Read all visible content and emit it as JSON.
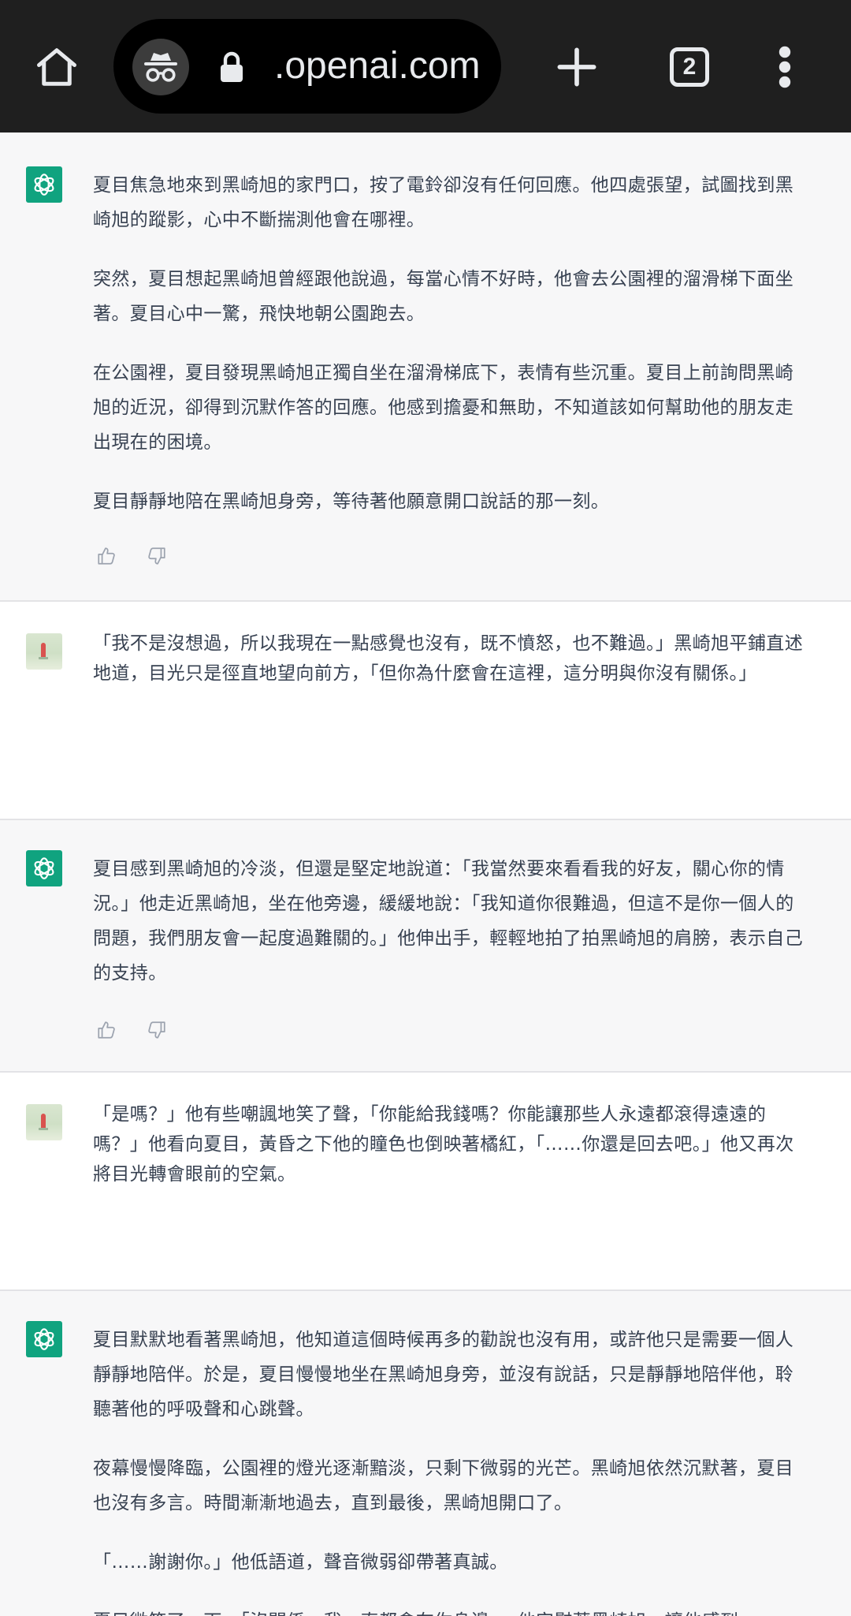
{
  "browser": {
    "url": ".openai.com",
    "tab_count": "2"
  },
  "messages": [
    {
      "role": "assistant",
      "paragraphs": [
        "夏目焦急地來到黑崎旭的家門口，按了電鈴卻沒有任何回應。他四處張望，試圖找到黑崎旭的蹤影，心中不斷揣測他會在哪裡。",
        "突然，夏目想起黑崎旭曾經跟他說過，每當心情不好時，他會去公園裡的溜滑梯下面坐著。夏目心中一驚，飛快地朝公園跑去。",
        "在公園裡，夏目發現黑崎旭正獨自坐在溜滑梯底下，表情有些沉重。夏目上前詢問黑崎旭的近況，卻得到沉默作答的回應。他感到擔憂和無助，不知道該如何幫助他的朋友走出現在的困境。",
        "夏目靜靜地陪在黑崎旭身旁，等待著他願意開口說話的那一刻。"
      ]
    },
    {
      "role": "user",
      "paragraphs": [
        "「我不是沒想過，所以我現在一點感覺也沒有，既不憤怒，也不難過。」黑崎旭平鋪直述地道，目光只是徑直地望向前方，「但你為什麼會在這裡，這分明與你沒有關係。」"
      ]
    },
    {
      "role": "assistant",
      "paragraphs": [
        "夏目感到黑崎旭的冷淡，但還是堅定地說道：「我當然要來看看我的好友，關心你的情況。」他走近黑崎旭，坐在他旁邊，緩緩地說：「我知道你很難過，但這不是你一個人的問題，我們朋友會一起度過難關的。」他伸出手，輕輕地拍了拍黑崎旭的肩膀，表示自己的支持。"
      ]
    },
    {
      "role": "user",
      "paragraphs": [
        "「是嗎？」他有些嘲諷地笑了聲，「你能給我錢嗎？你能讓那些人永遠都滾得遠遠的嗎？」他看向夏目，黃昏之下他的瞳色也倒映著橘紅，「……你還是回去吧。」他又再次將目光轉會眼前的空氣。"
      ]
    },
    {
      "role": "assistant",
      "paragraphs": [
        "夏目默默地看著黑崎旭，他知道這個時候再多的勸說也沒有用，或許他只是需要一個人靜靜地陪伴。於是，夏目慢慢地坐在黑崎旭身旁，並沒有說話，只是靜靜地陪伴他，聆聽著他的呼吸聲和心跳聲。",
        "夜幕慢慢降臨，公園裡的燈光逐漸黯淡，只剩下微弱的光芒。黑崎旭依然沉默著，夏目也沒有多言。時間漸漸地過去，直到最後，黑崎旭開口了。",
        "「……謝謝你。」他低語道，聲音微弱卻帶著真誠。",
        "夏目微笑了一下，「沒關係，我一直都會在你身邊。」他安慰著黑崎旭，讓他感到"
      ]
    }
  ],
  "icons": {
    "home": "home-icon",
    "incognito": "incognito-icon",
    "lock": "lock-icon",
    "new_tab": "plus-icon",
    "tabs": "tab-switcher-icon",
    "menu": "more-vert-icon",
    "assistant_avatar": "openai-logo-icon",
    "thumbs_up": "thumbs-up-icon",
    "thumbs_down": "thumbs-down-icon"
  },
  "colors": {
    "toolbar_bg": "#1f1f1f",
    "assistant_bg": "#f7f7f8",
    "user_bg": "#ffffff",
    "brand_green": "#10a37f",
    "text": "#374151"
  }
}
